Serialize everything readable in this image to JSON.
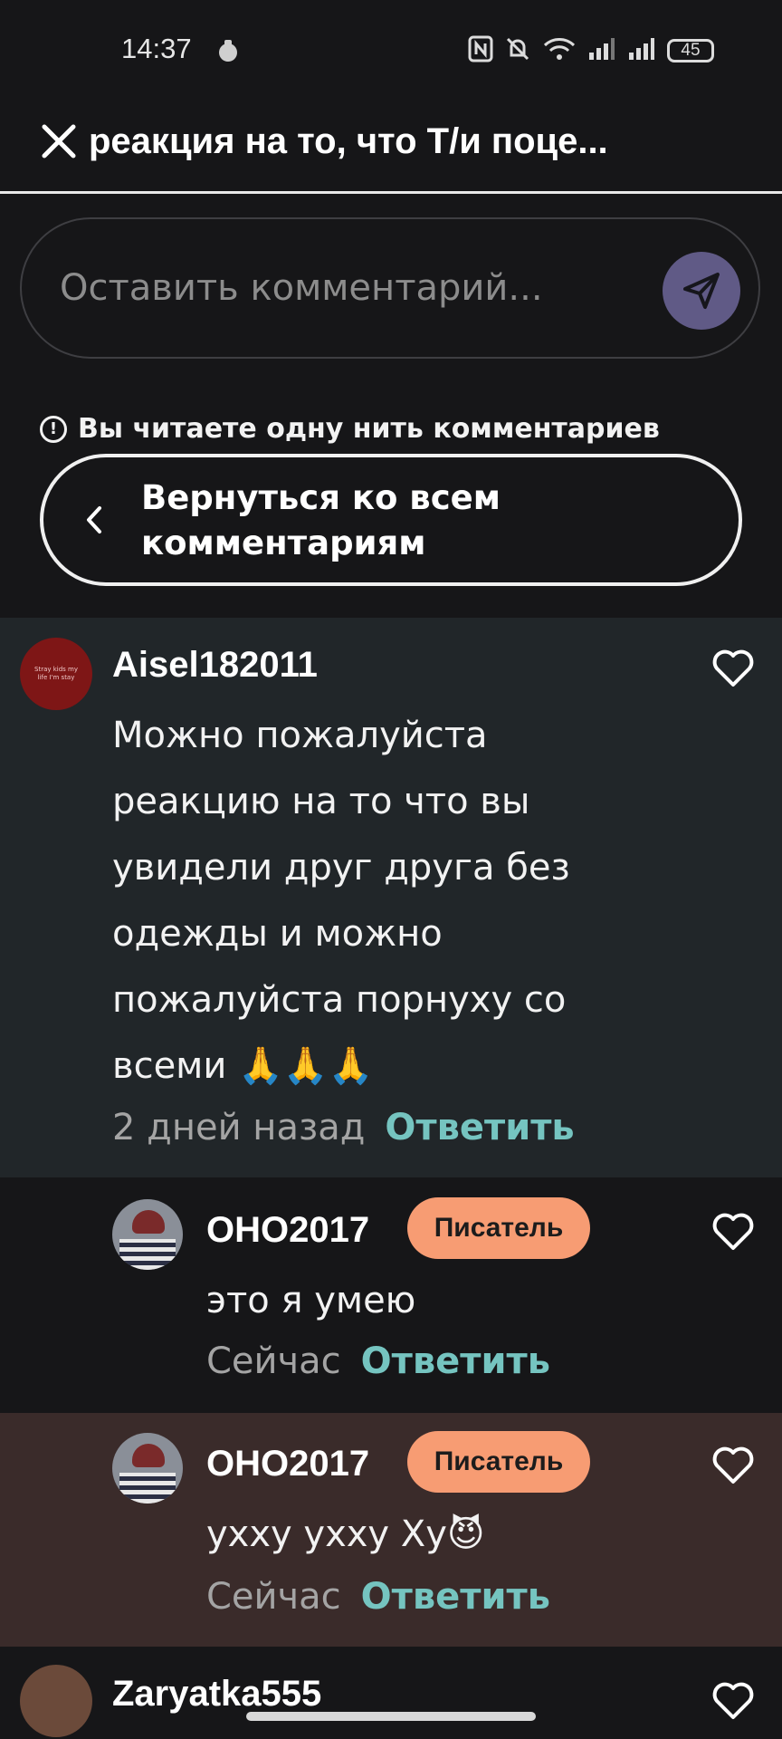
{
  "status": {
    "time": "14:37",
    "battery": "45"
  },
  "header": {
    "title": "реакция на то, что Т/и поце..."
  },
  "comment_box": {
    "placeholder": "Оставить комментарий..."
  },
  "thread": {
    "notice": "Вы читаете одну нить комментариев",
    "back_label": "Вернуться ко всем комментариям"
  },
  "comments": [
    {
      "user": "Aisel182011",
      "avatar_text": "Stray kids my life I'm stay",
      "text": "Можно пожалуйста реакцию на то что вы увидели друг друга без одежды и можно пожалуйста порнуху со всеми 🙏🙏🙏",
      "time": "2 дней назад",
      "reply": "Ответить"
    },
    {
      "user": "OHO2017",
      "badge": "Писатель",
      "text": "это я умею",
      "time": "Сейчас",
      "reply": "Ответить"
    },
    {
      "user": "OHO2017",
      "badge": "Писатель",
      "text": "ухху ухху Ху😈",
      "time": "Сейчас",
      "reply": "Ответить"
    },
    {
      "user": "Zaryatka555"
    }
  ],
  "colors": {
    "background": "#161618",
    "parent_comment_bg": "#212629",
    "highlight_reply_bg": "#3a2b2a",
    "badge_bg": "#f79c73",
    "reply_link": "#75c4c0",
    "send_button": "#605a86"
  }
}
